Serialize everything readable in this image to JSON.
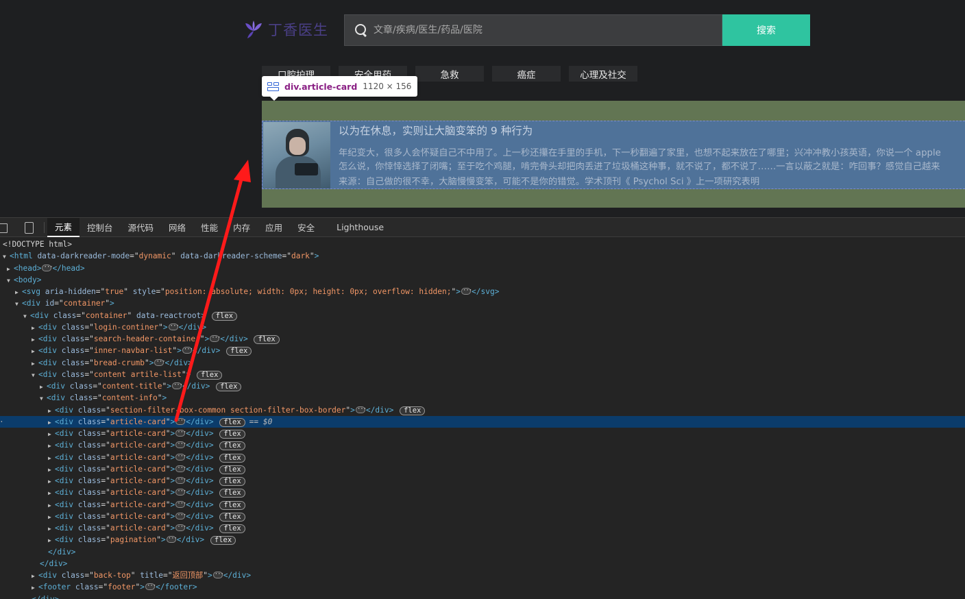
{
  "site": {
    "logo_text": "丁香医生",
    "search_placeholder": "文章/疾病/医生/药品/医院",
    "search_button": "搜索",
    "tags": [
      "口腔护理",
      "安全用药",
      "急救",
      "癌症",
      "心理及社交"
    ],
    "colors": {
      "accent": "#2fc4a0",
      "logo": "#6b4fc9"
    }
  },
  "tooltip": {
    "selector": "div.article-card",
    "size": "1120 × 156"
  },
  "article": {
    "title": "以为在休息，实则让大脑变笨的 9 种行为",
    "desc_line1": "年纪变大，很多人会怀疑自己不中用了。上一秒还攥在手里的手机，下一秒翻遍了家里，也想不起来放在了哪里；兴冲冲教小孩英语，你说一个 apple",
    "desc_line2": "怎么说，你悻悻选择了闭嘴；至于吃个鸡腿，啃完骨头却把肉丢进了垃圾桶这种事，就不说了，都不说了……一言以蔽之就是：咋回事？感觉自己越来",
    "source": "来源：自己做的很不幸，大脑慢慢变笨，可能不是你的错觉。学术顶刊《 Psychol Sci 》上一项研究表明"
  },
  "devtools": {
    "tabs": [
      "元素",
      "控制台",
      "源代码",
      "网络",
      "性能",
      "内存",
      "应用",
      "安全",
      "Lighthouse"
    ],
    "lines": [
      {
        "t": "<!DOCTYPE html>"
      },
      {
        "tag": "html",
        "attrs": "data-darkreader-mode=\"dynamic\" data-darkreader-scheme=\"dark\""
      },
      {
        "tag": "head"
      },
      {
        "tag": "body"
      },
      {
        "tag": "svg",
        "attrs": "aria-hidden=\"true\" style=\"position: absolute; width: 0px; height: 0px; overflow: hidden;\""
      },
      {
        "tag": "div",
        "attrs": "id=\"container\""
      },
      {
        "tag": "div",
        "attrs": "class=\"container\" data-reactroot",
        "badge": "flex"
      },
      {
        "tag": "div",
        "attrs": "class=\"login-continer\""
      },
      {
        "tag": "div",
        "attrs": "class=\"search-header-container\"",
        "badge": "flex"
      },
      {
        "tag": "div",
        "attrs": "class=\"inner-navbar-list\"",
        "badge": "flex"
      },
      {
        "tag": "div",
        "attrs": "class=\"bread-crumb\""
      },
      {
        "tag": "div",
        "attrs": "class=\"content artile-list\"",
        "badge": "flex"
      },
      {
        "tag": "div",
        "attrs": "class=\"content-title\"",
        "badge": "flex"
      },
      {
        "tag": "div",
        "attrs": "class=\"content-info\""
      },
      {
        "tag": "div",
        "attrs": "class=\"section-filter-box-common section-filter-box-border\"",
        "badge": "flex"
      },
      {
        "tag": "div",
        "attrs": "class=\"article-card\"",
        "badge": "flex",
        "eq": "== $0"
      },
      {
        "tag": "div",
        "attrs": "class=\"pagination\"",
        "badge": "flex"
      },
      {
        "tag": "div",
        "attrs": "class=\"back-top\" title=\"返回顶部\""
      },
      {
        "tag": "footer",
        "attrs": "class=\"footer\""
      }
    ]
  }
}
